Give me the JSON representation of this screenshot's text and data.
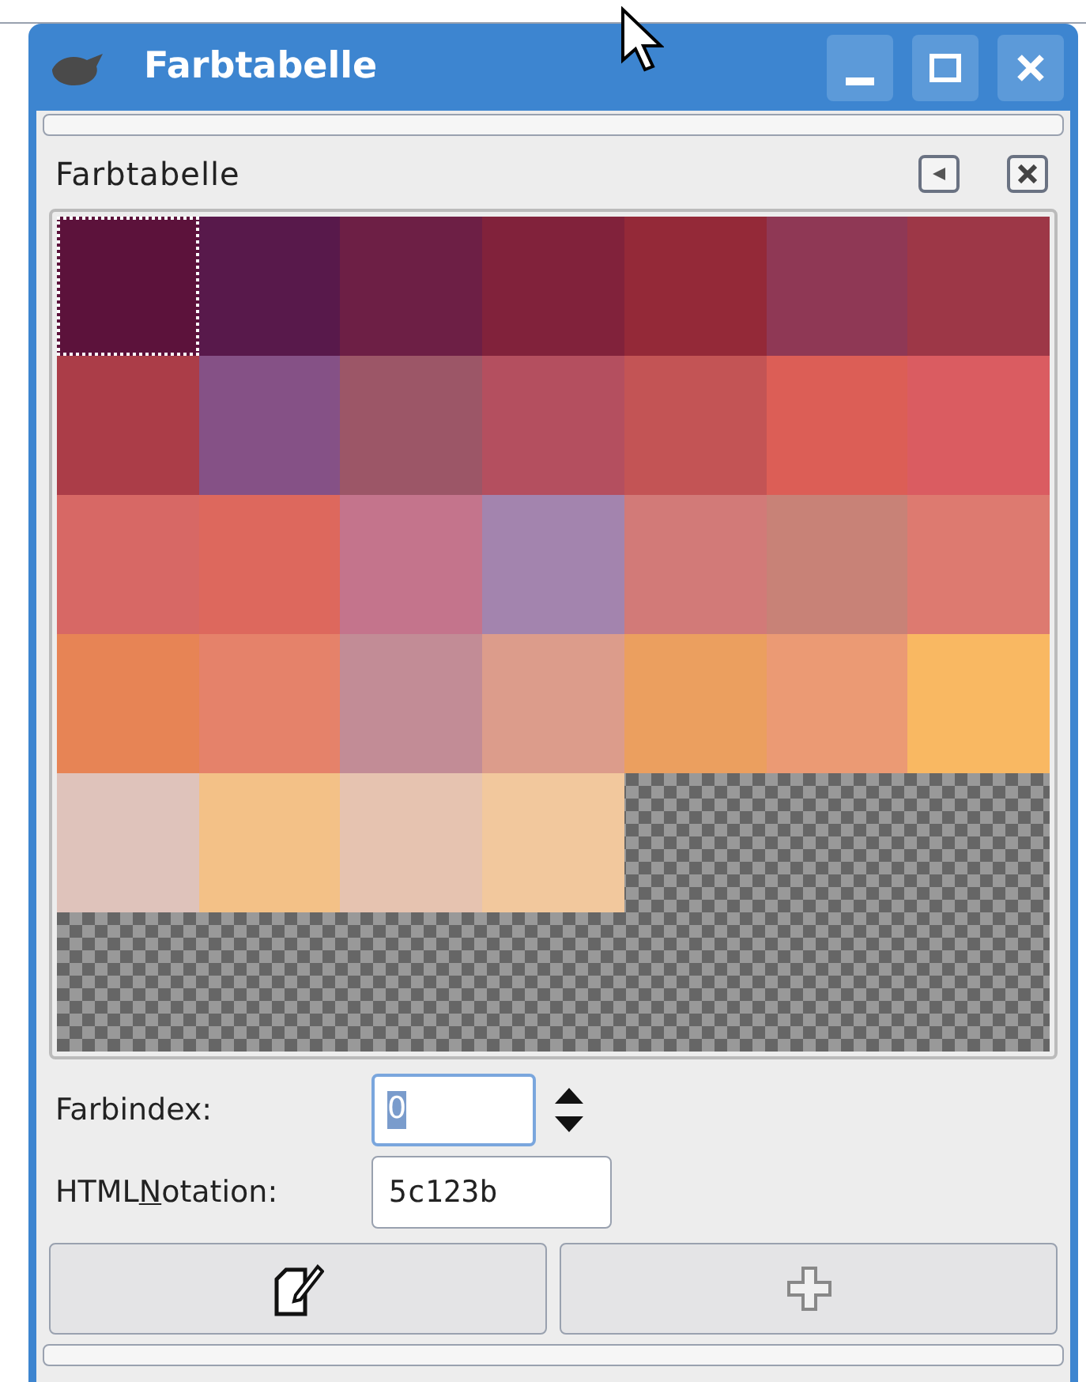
{
  "window": {
    "title": "Farbtabelle"
  },
  "panel": {
    "title": "Farbtabelle"
  },
  "swatches": [
    {
      "color": "#5c123b",
      "selected": true
    },
    {
      "color": "#58194b",
      "selected": false
    },
    {
      "color": "#6d1f45",
      "selected": false
    },
    {
      "color": "#81223b",
      "selected": false
    },
    {
      "color": "#942938",
      "selected": false
    },
    {
      "color": "#8f3855",
      "selected": false
    },
    {
      "color": "#9d3747",
      "selected": false
    },
    {
      "color": "#ab3d48",
      "selected": false
    },
    {
      "color": "#855186",
      "selected": false
    },
    {
      "color": "#9c5667",
      "selected": false
    },
    {
      "color": "#b44f5f",
      "selected": false
    },
    {
      "color": "#c35455",
      "selected": false
    },
    {
      "color": "#dc5e56",
      "selected": false
    },
    {
      "color": "#da5c61",
      "selected": false
    },
    {
      "color": "#d76865",
      "selected": false
    },
    {
      "color": "#dd685d",
      "selected": false
    },
    {
      "color": "#c4748c",
      "selected": false
    },
    {
      "color": "#a384ae",
      "selected": false
    },
    {
      "color": "#d27a78",
      "selected": false
    },
    {
      "color": "#c88277",
      "selected": false
    },
    {
      "color": "#dd7a70",
      "selected": false
    },
    {
      "color": "#e78455",
      "selected": false
    },
    {
      "color": "#e5826a",
      "selected": false
    },
    {
      "color": "#c28c96",
      "selected": false
    },
    {
      "color": "#dc9c8b",
      "selected": false
    },
    {
      "color": "#eb9f5f",
      "selected": false
    },
    {
      "color": "#eb9a74",
      "selected": false
    },
    {
      "color": "#f9b862",
      "selected": false
    },
    {
      "color": "#dfc3bb",
      "selected": false
    },
    {
      "color": "#f3c187",
      "selected": false
    },
    {
      "color": "#e6c3b0",
      "selected": false
    },
    {
      "color": "#f2c89d",
      "selected": false
    }
  ],
  "index_field": {
    "label": "Farbindex:",
    "value": "0"
  },
  "html_field": {
    "label_parts": [
      {
        "text": "HTML",
        "underlined": false
      },
      {
        "text": "N",
        "underlined": true
      },
      {
        "text": "otation:",
        "underlined": false
      }
    ],
    "value": "5c123b"
  },
  "buttons": [
    {
      "kind": "edit",
      "disabled": false
    },
    {
      "kind": "add",
      "disabled": true
    }
  ]
}
